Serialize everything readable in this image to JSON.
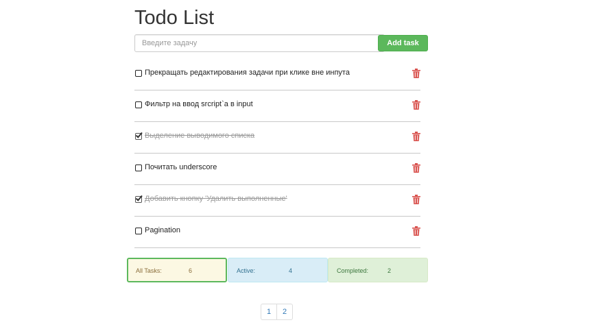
{
  "app": {
    "title": "Todo List"
  },
  "new_task": {
    "placeholder": "Введите задачу",
    "value": "",
    "add_label": "Add task"
  },
  "tasks": [
    {
      "text": "Прекращать редактирования задачи при клике вне инпута",
      "completed": false
    },
    {
      "text": "Фильтр на ввод srcript`a в input",
      "completed": false
    },
    {
      "text": "Выделение выводимого списка",
      "completed": true
    },
    {
      "text": "Почитать underscore",
      "completed": false
    },
    {
      "text": "Добавить кнопку 'Удалить выполненные'",
      "completed": true
    },
    {
      "text": "Pagination",
      "completed": false
    }
  ],
  "filters": {
    "all": {
      "label": "All Tasks:",
      "count": "6"
    },
    "active": {
      "label": "Active:",
      "count": "4"
    },
    "completed": {
      "label": "Completed:",
      "count": "2"
    }
  },
  "pagination": {
    "pages": [
      "1",
      "2"
    ]
  },
  "colors": {
    "accent": "#5cb85c",
    "danger": "#d9534f",
    "link": "#337ab7",
    "completed_text": "#999999"
  },
  "icons": {
    "delete": "trash-icon",
    "checkbox": "checkbox-icon",
    "checked": "checkbox-checked-icon"
  }
}
